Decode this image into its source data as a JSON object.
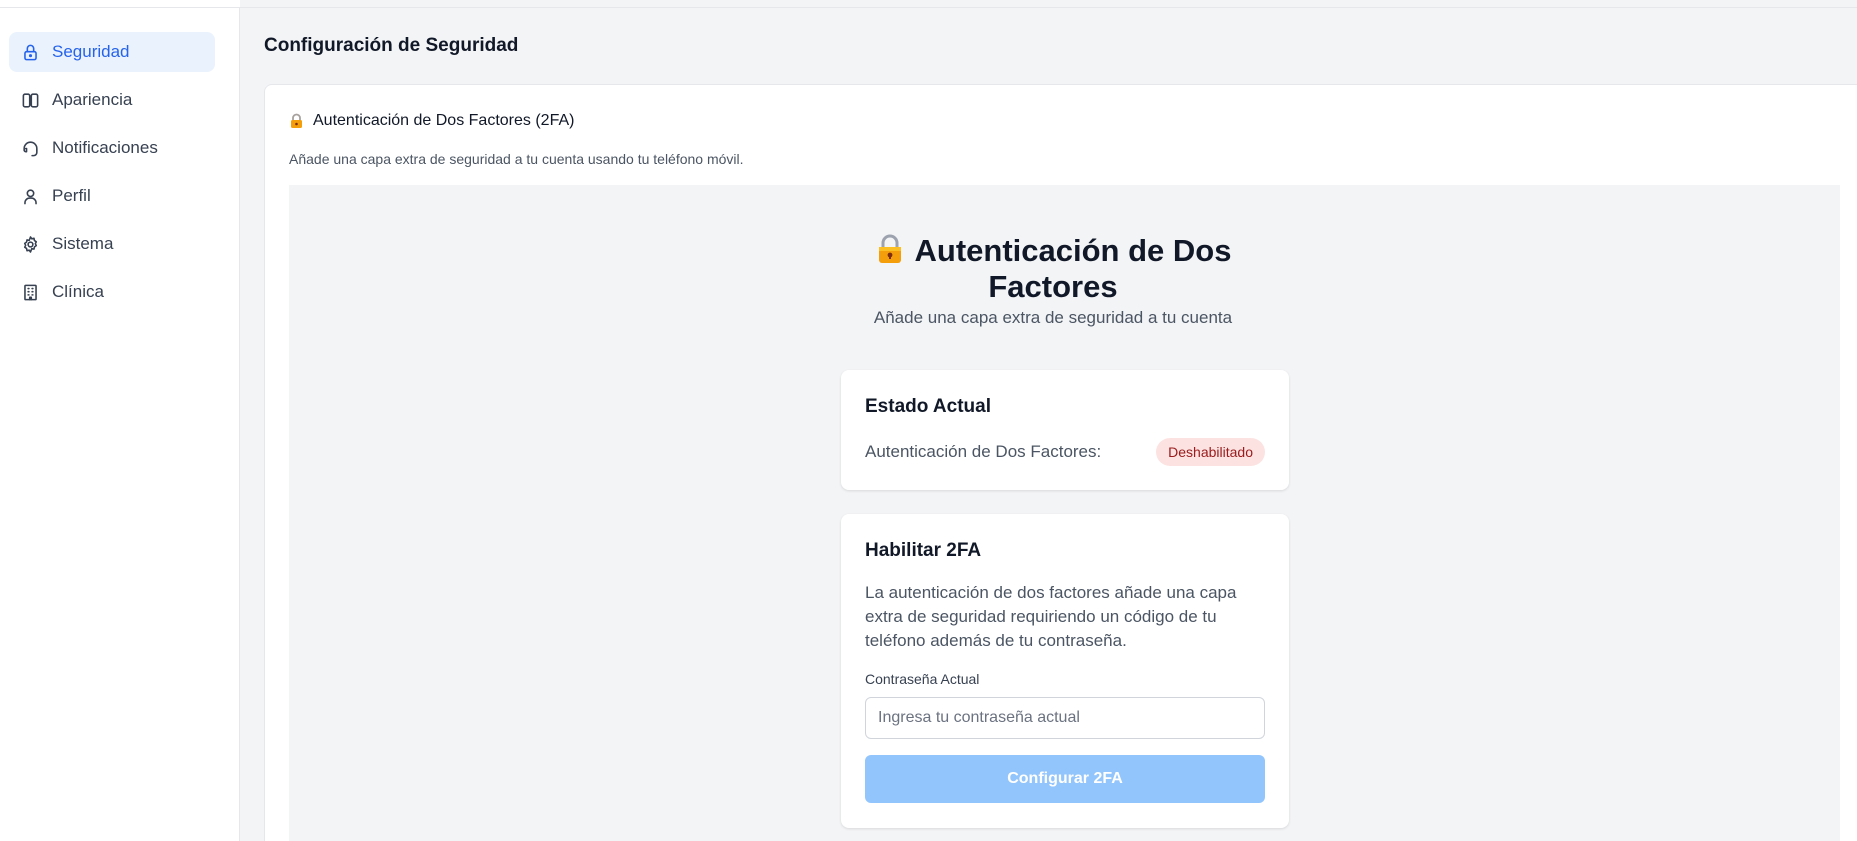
{
  "sidebar": {
    "items": [
      {
        "label": "Seguridad",
        "icon": "lock-icon",
        "active": true
      },
      {
        "label": "Apariencia",
        "icon": "columns-icon",
        "active": false
      },
      {
        "label": "Notificaciones",
        "icon": "headset-icon",
        "active": false
      },
      {
        "label": "Perfil",
        "icon": "user-icon",
        "active": false
      },
      {
        "label": "Sistema",
        "icon": "gear-icon",
        "active": false
      },
      {
        "label": "Clínica",
        "icon": "building-icon",
        "active": false
      }
    ]
  },
  "main": {
    "page_title": "Configuración de Seguridad",
    "card": {
      "title": "Autenticación de Dos Factores (2FA)",
      "subtitle": "Añade una capa extra de seguridad a tu cuenta usando tu teléfono móvil.",
      "hero": {
        "title": "Autenticación de Dos Factores",
        "subtitle": "Añade una capa extra de seguridad a tu cuenta"
      },
      "status": {
        "title": "Estado Actual",
        "label": "Autenticación de Dos Factores:",
        "badge": "Deshabilitado"
      },
      "enable": {
        "title": "Habilitar 2FA",
        "description": "La autenticación de dos factores añade una capa extra de seguridad requiriendo un código de tu teléfono además de tu contraseña.",
        "password_label": "Contraseña Actual",
        "password_placeholder": "Ingresa tu contraseña actual",
        "button_label": "Configurar 2FA"
      }
    }
  },
  "colors": {
    "accent": "#2563eb",
    "active_bg": "#eaf2fe",
    "badge_bg": "#fde2e2",
    "badge_text": "#991b1b",
    "button_disabled": "#93c5fd"
  }
}
